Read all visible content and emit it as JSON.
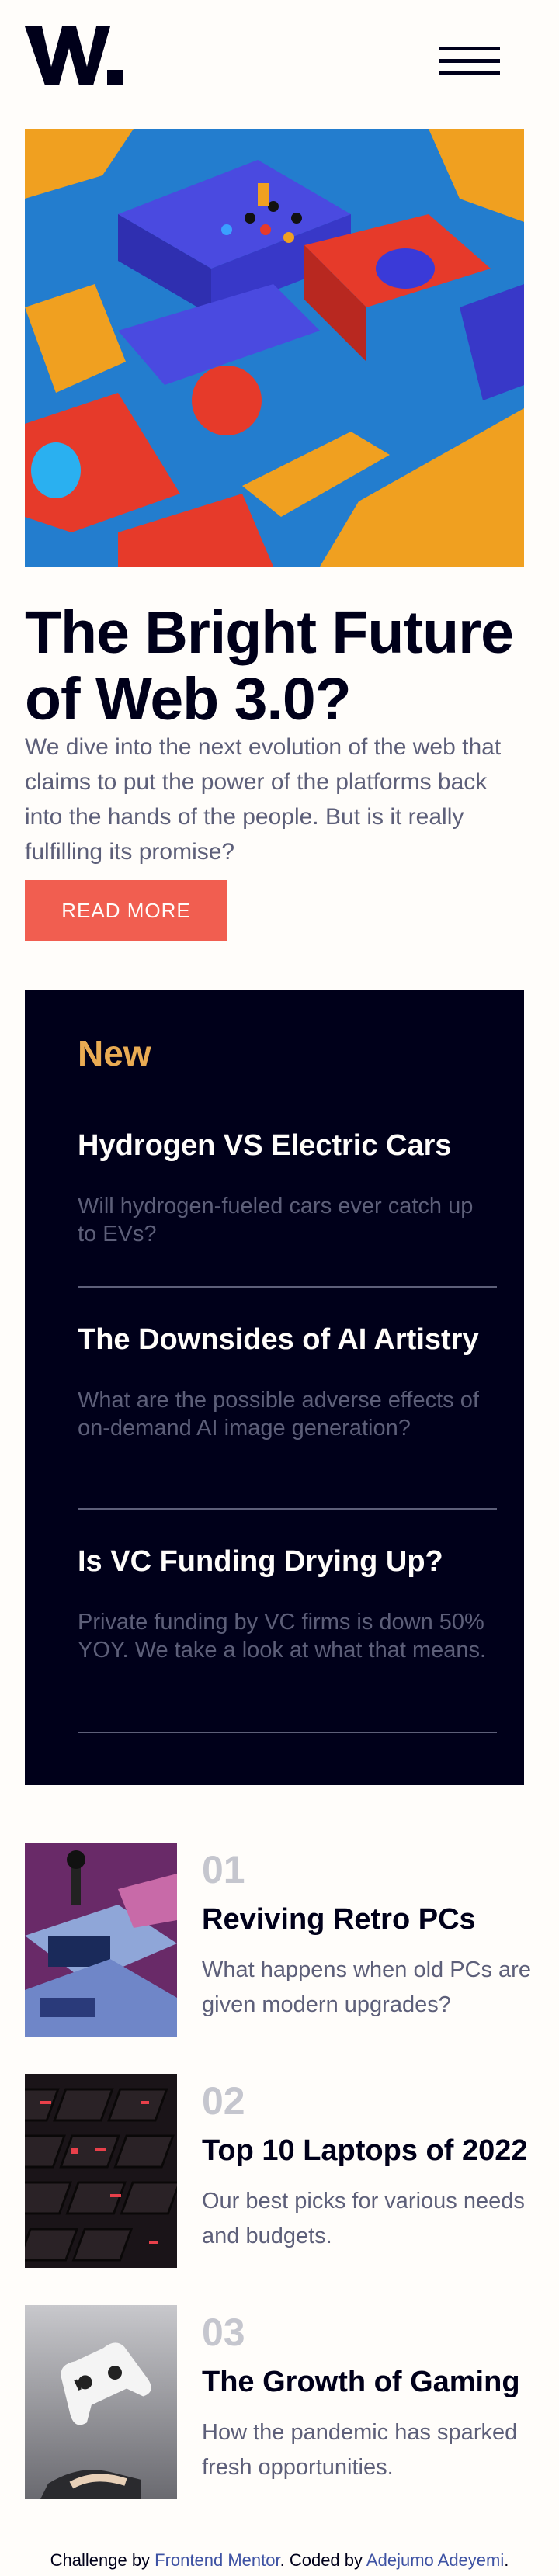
{
  "header": {
    "logo_text": "W.",
    "menu_icon": "hamburger-menu-icon"
  },
  "hero": {
    "image_description_icon": "abstract-3d-shapes-image",
    "title": "The Bright Future of Web 3.0?",
    "description": "We dive into the next evolution of the web that claims to put the power of the platforms back into the hands of the people. But is it really fulfilling its promise?",
    "button_label": "READ MORE"
  },
  "new_section": {
    "heading": "New",
    "items": [
      {
        "title": "Hydrogen VS Electric Cars",
        "description": "Will hydrogen-fueled cars ever catch up to EVs?"
      },
      {
        "title": "The Downsides of AI Artistry",
        "description": "What are the possible adverse effects of on-demand AI image generation?"
      },
      {
        "title": "Is VC Funding Drying Up?",
        "description": "Private funding by VC firms is down 50% YOY. We take a look at what that means."
      }
    ]
  },
  "articles": [
    {
      "number": "01",
      "title": "Reviving Retro PCs",
      "description": "What happens when old PCs are given modern upgrades?"
    },
    {
      "number": "02",
      "title": "Top 10 Laptops of 2022",
      "description": "Our best picks for various needs and budgets."
    },
    {
      "number": "03",
      "title": "The Growth of Gaming",
      "description": "How the pandemic has sparked fresh opportunities."
    }
  ],
  "footer": {
    "prefix": "Challenge by ",
    "link1": "Frontend Mentor",
    "middle": ". Coded by ",
    "link2": "Adejumo Adeyemi",
    "suffix": "."
  },
  "colors": {
    "background": "#fffdfa",
    "accent_red": "#f15e50",
    "accent_orange": "#e9ab53",
    "dark_navy": "#00001a",
    "grayish_blue": "#5d5f79"
  }
}
